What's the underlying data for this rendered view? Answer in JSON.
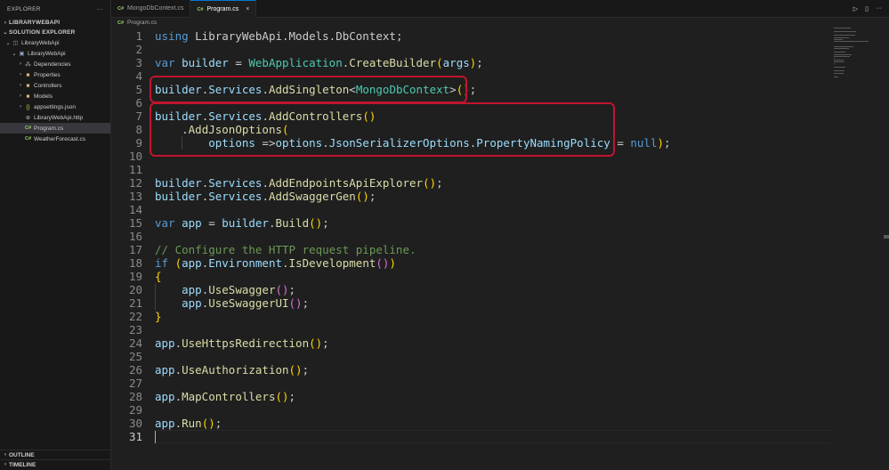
{
  "sidebar": {
    "title": "EXPLORER",
    "more": "···",
    "workspace": "LIBRARYWEBAPI",
    "solution_explorer": "SOLUTION EXPLORER",
    "tree": [
      {
        "label": "LibraryWebApi",
        "icon": "solution-icon",
        "chev": "⌄",
        "indent": 1
      },
      {
        "label": "LibraryWebApi",
        "icon": "project-icon",
        "chev": "⌄",
        "indent": 2
      },
      {
        "label": "Dependencies",
        "icon": "dependencies-icon",
        "chev": "›",
        "indent": 3
      },
      {
        "label": "Properties",
        "icon": "folder-icon",
        "chev": "›",
        "indent": 3
      },
      {
        "label": "Controllers",
        "icon": "folder-icon",
        "chev": "›",
        "indent": 3
      },
      {
        "label": "Models",
        "icon": "folder-icon",
        "chev": "›",
        "indent": 3
      },
      {
        "label": "appsettings.json",
        "icon": "json-icon",
        "chev": "›",
        "indent": 3
      },
      {
        "label": "LibraryWebApi.http",
        "icon": "http-icon",
        "chev": "",
        "indent": 3
      },
      {
        "label": "Program.cs",
        "icon": "csharp-icon",
        "chev": "",
        "indent": 3,
        "selected": true
      },
      {
        "label": "WeatherForecast.cs",
        "icon": "csharp-icon",
        "chev": "",
        "indent": 3
      }
    ],
    "outline": "OUTLINE",
    "timeline": "TIMELINE"
  },
  "tabs": [
    {
      "label": "MongoDbContext.cs",
      "icon_text": "C#",
      "active": false
    },
    {
      "label": "Program.cs",
      "icon_text": "C#",
      "active": true,
      "close": "×"
    }
  ],
  "tab_actions": {
    "run": "▷",
    "split": "▯",
    "more": "···"
  },
  "breadcrumb": {
    "icon_text": "C#",
    "file": "Program.cs"
  },
  "editor": {
    "current_line": 31,
    "lines": [
      {
        "n": "1",
        "tokens": [
          [
            "kw",
            "using "
          ],
          [
            "ns",
            "LibraryWebApi.Models.DbContext"
          ],
          [
            "pl",
            ";"
          ]
        ]
      },
      {
        "n": "2",
        "tokens": []
      },
      {
        "n": "3",
        "tokens": [
          [
            "kw",
            "var "
          ],
          [
            "id",
            "builder"
          ],
          [
            "pl",
            " = "
          ],
          [
            "ty",
            "WebApplication"
          ],
          [
            "pl",
            "."
          ],
          [
            "fn",
            "CreateBuilder"
          ],
          [
            "b1",
            "("
          ],
          [
            "id",
            "args"
          ],
          [
            "b1",
            ")"
          ],
          [
            "pl",
            ";"
          ]
        ]
      },
      {
        "n": "4",
        "tokens": []
      },
      {
        "n": "5",
        "tokens": [
          [
            "id",
            "builder"
          ],
          [
            "pl",
            "."
          ],
          [
            "id",
            "Services"
          ],
          [
            "pl",
            "."
          ],
          [
            "fn",
            "AddSingleton"
          ],
          [
            "pl",
            "<"
          ],
          [
            "ty",
            "MongoDbContext"
          ],
          [
            "pl",
            ">"
          ],
          [
            "b1",
            "()"
          ],
          [
            "pl",
            ";"
          ]
        ]
      },
      {
        "n": "6",
        "tokens": []
      },
      {
        "n": "7",
        "tokens": [
          [
            "id",
            "builder"
          ],
          [
            "pl",
            "."
          ],
          [
            "id",
            "Services"
          ],
          [
            "pl",
            "."
          ],
          [
            "fn",
            "AddControllers"
          ],
          [
            "b1",
            "()"
          ]
        ]
      },
      {
        "n": "8",
        "tokens": [
          [
            "pl",
            "    ."
          ],
          [
            "fn",
            "AddJsonOptions"
          ],
          [
            "b1",
            "("
          ]
        ]
      },
      {
        "n": "9",
        "tokens": [
          [
            "pl",
            "        "
          ],
          [
            "id",
            "options"
          ],
          [
            "pl",
            " =>"
          ],
          [
            "id",
            "options"
          ],
          [
            "pl",
            "."
          ],
          [
            "id",
            "JsonSerializerOptions"
          ],
          [
            "pl",
            "."
          ],
          [
            "id",
            "PropertyNamingPolicy"
          ],
          [
            "pl",
            " = "
          ],
          [
            "kw",
            "null"
          ],
          [
            "b1",
            ")"
          ],
          [
            "pl",
            ";"
          ]
        ]
      },
      {
        "n": "10",
        "tokens": []
      },
      {
        "n": "11",
        "tokens": []
      },
      {
        "n": "12",
        "tokens": [
          [
            "id",
            "builder"
          ],
          [
            "pl",
            "."
          ],
          [
            "id",
            "Services"
          ],
          [
            "pl",
            "."
          ],
          [
            "fn",
            "AddEndpointsApiExplorer"
          ],
          [
            "b1",
            "()"
          ],
          [
            "pl",
            ";"
          ]
        ]
      },
      {
        "n": "13",
        "tokens": [
          [
            "id",
            "builder"
          ],
          [
            "pl",
            "."
          ],
          [
            "id",
            "Services"
          ],
          [
            "pl",
            "."
          ],
          [
            "fn",
            "AddSwaggerGen"
          ],
          [
            "b1",
            "()"
          ],
          [
            "pl",
            ";"
          ]
        ]
      },
      {
        "n": "14",
        "tokens": []
      },
      {
        "n": "15",
        "tokens": [
          [
            "kw",
            "var "
          ],
          [
            "id",
            "app"
          ],
          [
            "pl",
            " = "
          ],
          [
            "id",
            "builder"
          ],
          [
            "pl",
            "."
          ],
          [
            "fn",
            "Build"
          ],
          [
            "b1",
            "()"
          ],
          [
            "pl",
            ";"
          ]
        ]
      },
      {
        "n": "16",
        "tokens": []
      },
      {
        "n": "17",
        "tokens": [
          [
            "cm",
            "// Configure the HTTP request pipeline."
          ]
        ]
      },
      {
        "n": "18",
        "tokens": [
          [
            "kw",
            "if "
          ],
          [
            "b1",
            "("
          ],
          [
            "id",
            "app"
          ],
          [
            "pl",
            "."
          ],
          [
            "id",
            "Environment"
          ],
          [
            "pl",
            "."
          ],
          [
            "fn",
            "IsDevelopment"
          ],
          [
            "b2",
            "()"
          ],
          [
            "b1",
            ")"
          ]
        ]
      },
      {
        "n": "19",
        "tokens": [
          [
            "b1",
            "{"
          ]
        ]
      },
      {
        "n": "20",
        "tokens": [
          [
            "pl",
            "    "
          ],
          [
            "id",
            "app"
          ],
          [
            "pl",
            "."
          ],
          [
            "fn",
            "UseSwagger"
          ],
          [
            "b2",
            "()"
          ],
          [
            "pl",
            ";"
          ]
        ]
      },
      {
        "n": "21",
        "tokens": [
          [
            "pl",
            "    "
          ],
          [
            "id",
            "app"
          ],
          [
            "pl",
            "."
          ],
          [
            "fn",
            "UseSwaggerUI"
          ],
          [
            "b2",
            "()"
          ],
          [
            "pl",
            ";"
          ]
        ]
      },
      {
        "n": "22",
        "tokens": [
          [
            "b1",
            "}"
          ]
        ]
      },
      {
        "n": "23",
        "tokens": []
      },
      {
        "n": "24",
        "tokens": [
          [
            "id",
            "app"
          ],
          [
            "pl",
            "."
          ],
          [
            "fn",
            "UseHttpsRedirection"
          ],
          [
            "b1",
            "()"
          ],
          [
            "pl",
            ";"
          ]
        ]
      },
      {
        "n": "25",
        "tokens": []
      },
      {
        "n": "26",
        "tokens": [
          [
            "id",
            "app"
          ],
          [
            "pl",
            "."
          ],
          [
            "fn",
            "UseAuthorization"
          ],
          [
            "b1",
            "()"
          ],
          [
            "pl",
            ";"
          ]
        ]
      },
      {
        "n": "27",
        "tokens": []
      },
      {
        "n": "28",
        "tokens": [
          [
            "id",
            "app"
          ],
          [
            "pl",
            "."
          ],
          [
            "fn",
            "MapControllers"
          ],
          [
            "b1",
            "()"
          ],
          [
            "pl",
            ";"
          ]
        ]
      },
      {
        "n": "29",
        "tokens": []
      },
      {
        "n": "30",
        "tokens": [
          [
            "id",
            "app"
          ],
          [
            "pl",
            "."
          ],
          [
            "fn",
            "Run"
          ],
          [
            "b1",
            "()"
          ],
          [
            "pl",
            ";"
          ]
        ]
      },
      {
        "n": "31",
        "tokens": []
      }
    ]
  },
  "colors": {
    "highlight_box": "#c0152f",
    "accent": "#0078d4"
  }
}
